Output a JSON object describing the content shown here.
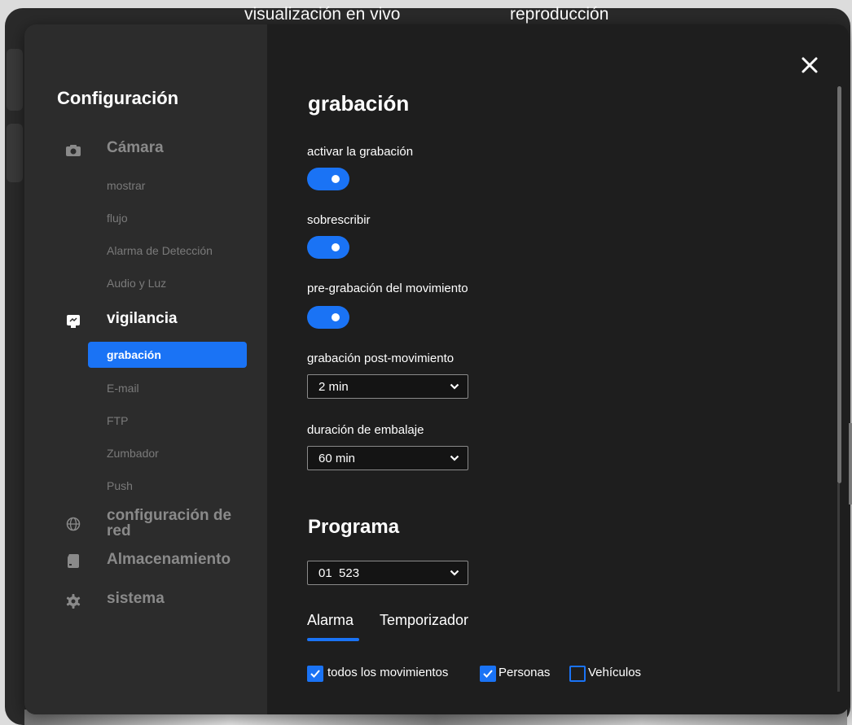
{
  "topnav": {
    "live_view": "visualización en vivo",
    "playback": "reproducción"
  },
  "sidebar": {
    "title": "Configuración",
    "sections": {
      "camera": {
        "label": "Cámara",
        "icon": "camera-icon",
        "items": [
          "mostrar",
          "flujo",
          "Alarma de Detección",
          "Audio y Luz"
        ]
      },
      "surveillance": {
        "label": "vigilancia",
        "icon": "monitor-icon",
        "items": [
          "grabación",
          "E-mail",
          "FTP",
          "Zumbador",
          "Push"
        ],
        "selected": "grabación"
      },
      "network": {
        "label": "configuración de red",
        "icon": "globe-icon"
      },
      "storage": {
        "label": "Almacenamiento",
        "icon": "sd-card-icon"
      },
      "system": {
        "label": "sistema",
        "icon": "gear-icon"
      }
    }
  },
  "content": {
    "title": "grabación",
    "enable_recording": {
      "label": "activar la grabación",
      "on": true
    },
    "overwrite": {
      "label": "sobrescribir",
      "on": true
    },
    "pre_recording": {
      "label": "pre-grabación del movimiento",
      "on": true
    },
    "post_motion": {
      "label": "grabación post-movimiento",
      "value": "2 min"
    },
    "pack_duration": {
      "label": "duración de embalaje",
      "value": "60 min"
    },
    "schedule": {
      "title": "Programa",
      "value": "01  523",
      "tabs": [
        "Alarma",
        "Temporizador"
      ],
      "active_tab": "Alarma",
      "checks": [
        {
          "label": "todos los movimientos",
          "checked": true
        },
        {
          "label": "Personas",
          "checked": true
        },
        {
          "label": "Vehículos",
          "checked": false
        }
      ]
    }
  },
  "colors": {
    "accent": "#1a73f5",
    "sidebar_bg": "#2c2c2c",
    "content_bg": "#1e1e1e"
  }
}
